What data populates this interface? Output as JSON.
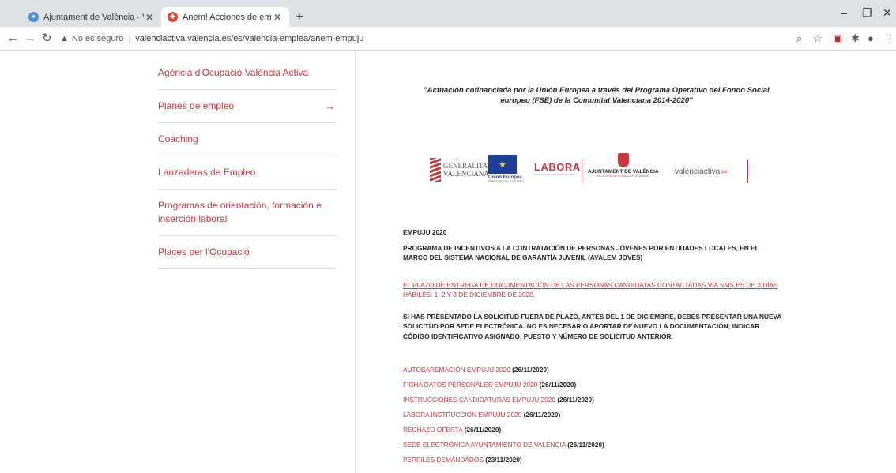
{
  "browser": {
    "tabs": [
      {
        "title": "Ajuntament de València - Valenti",
        "icon": "globe-favicon",
        "close": "✕"
      },
      {
        "title": "Anem! Acciones de empleo joven",
        "icon": "site-favicon",
        "close": "✕"
      }
    ],
    "new_tab": "+",
    "window_controls": {
      "minimize": "–",
      "restore": "❐",
      "close": "✕"
    },
    "nav": {
      "back": "←",
      "forward": "→",
      "reload": "↻"
    },
    "address": {
      "warning_icon": "▲",
      "security_label": "No es seguro",
      "separator": "|",
      "url": "valenciactiva.valencia.es/es/valencia-emplea/anem-empuju"
    },
    "toolbar_icons": {
      "zoom": "⌕",
      "bookmark": "☆",
      "extension": "▣",
      "puzzle": "✱",
      "account": "●",
      "menu": "⋮"
    }
  },
  "sidebar": {
    "items": [
      {
        "label": "Agència d'Ocupació València Activa",
        "arrow": ""
      },
      {
        "label": "Planes de empleo",
        "arrow": "→"
      },
      {
        "label": "Coaching",
        "arrow": ""
      },
      {
        "label": "Lanzaderas de Empleo",
        "arrow": ""
      },
      {
        "label": "Programas de orientación, formación e inserción laboral",
        "arrow": ""
      },
      {
        "label": "Places per l'Ocupació",
        "arrow": ""
      }
    ]
  },
  "content": {
    "quote": "\"Actuación cofinanciada por la Unión Europea a través del Programa Operativo del Fondo Social europeo (FSE) de la Comunitat Valenciana 2014-2020\"",
    "logos": {
      "gva": {
        "line1": "GENERALITAT",
        "line2": "VALENCIANA"
      },
      "ue": {
        "stars": "★",
        "caption": "Unión Europea",
        "sub": "FONDO SOCIAL EUROPEO"
      },
      "labora": {
        "name": "LABORA",
        "sub": "Servei Valencià d'Ocupació i Formació"
      },
      "ajuntament": {
        "title": "AJUNTAMENT DE VALÈNCIA",
        "sub": "REGIDORIA DE FORMACIÓ I OCUPACIÓ"
      },
      "valenciactiva": {
        "name": "valènciactiva",
        "dots": "ooo"
      },
      "accent_color": "#c8383f"
    },
    "title": "EMPUJU 2020",
    "program": "PROGRAMA DE INCENTIVOS A LA CONTRATACIÓN DE PERSONAS JÓVENES POR ENTIDADES LOCALES, EN EL MARCO DEL SISTEMA NACIONAL DE GARANTÍA JUVENIL (AVALEM JOVES)",
    "plazo": "EL PLAZO DE ENTREGA DE DOCUMENTACIÓN DE LAS PERSONAS CANDIDATAS CONTACTADAS VÍA SMS ES DE 3 DÍAS HÁBILES: 1, 2 Y 3 DE DICIEMBRE DE 2020.",
    "fuera_plazo": "SI HAS PRESENTADO LA SOLICITUD FUERA DE PLAZO, ANTES DEL 1 DE DICIEMBRE, DEBES PRESENTAR UNA NUEVA SOLICITUD POR SEDE ELECTRÓNICA. NO ES NECESARIO APORTAR DE NUEVO LA DOCUMENTACIÓN; INDICAR CÓDIGO IDENTIFICATIVO ASIGNADO, PUESTO Y NÚMERO DE SOLICITUD ANTERIOR.",
    "links": [
      {
        "label": "AUTOBAREMACIÓN EMPUJU 2020",
        "date": "(26/11/2020)"
      },
      {
        "label": "FICHA DATOS PERSONALES EMPUJU 2020",
        "date": "(26/11/2020)"
      },
      {
        "label": "INSTRUCCIONES CANDIDATURAS EMPUJU 2020",
        "date": "(26/11/2020)"
      },
      {
        "label": "LABORA INSTRUCCIÓN EMPUJU 2020",
        "date": "(26/11/2020)"
      },
      {
        "label": "RECHAZO OFERTA",
        "date": "(26/11/2020)"
      },
      {
        "label": "SEDE ELECTRÓNICA AYUNTAMIENTO DE VALÈNCIA",
        "date": "(26/11/2020)"
      },
      {
        "label": "PERFILES DEMANDADOS",
        "date": "(23/11/2020)"
      }
    ]
  }
}
